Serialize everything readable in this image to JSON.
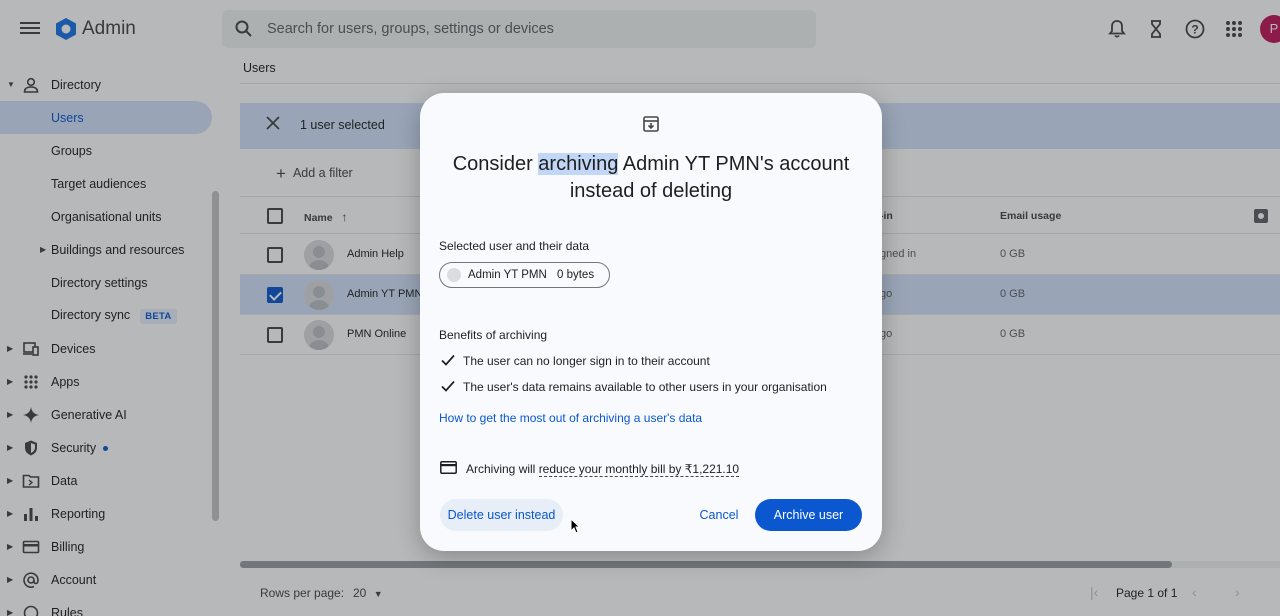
{
  "app": {
    "title": "Admin",
    "search_placeholder": "Search for users, groups, settings or devices",
    "avatar_initial": "P",
    "top_icons": [
      "bell-icon",
      "hourglass-icon",
      "help-icon",
      "apps-grid-icon"
    ]
  },
  "sidebar": {
    "items": [
      {
        "label": "Directory",
        "icon": "person-icon"
      },
      {
        "label": "Users"
      },
      {
        "label": "Groups"
      },
      {
        "label": "Target audiences"
      },
      {
        "label": "Organisational units"
      },
      {
        "label": "Buildings and resources"
      },
      {
        "label": "Directory settings"
      },
      {
        "label": "Directory sync",
        "badge": "BETA"
      },
      {
        "label": "Devices",
        "icon": "devices-icon"
      },
      {
        "label": "Apps",
        "icon": "apps-icon"
      },
      {
        "label": "Generative AI",
        "icon": "sparkle-icon"
      },
      {
        "label": "Security",
        "icon": "shield-icon"
      },
      {
        "label": "Data",
        "icon": "folder-icon"
      },
      {
        "label": "Reporting",
        "icon": "bar-chart-icon"
      },
      {
        "label": "Billing",
        "icon": "credit-card-icon"
      },
      {
        "label": "Account",
        "icon": "at-icon"
      },
      {
        "label": "Rules",
        "icon": "rules-icon"
      }
    ]
  },
  "main": {
    "breadcrumb": "Users",
    "selection_text": "1 user selected",
    "add_filter": "Add a filter",
    "columns": {
      "name": "Name",
      "last_sign_in": "-in",
      "email_usage": "Email usage"
    },
    "rows": [
      {
        "name": "Admin Help",
        "last_sign_in": "gned in",
        "email_usage": "0 GB",
        "checked": false
      },
      {
        "name": "Admin YT PMN",
        "last_sign_in": "go",
        "email_usage": "0 GB",
        "checked": true
      },
      {
        "name": "PMN Online",
        "last_sign_in": "go",
        "email_usage": "0 GB",
        "checked": false
      }
    ],
    "rows_per_page_label": "Rows per page:",
    "rows_per_page": "20",
    "page_label": "Page 1 of 1"
  },
  "dialog": {
    "title_before": "Consider ",
    "title_highlight": "archiving",
    "title_after": " Admin YT PMN's account instead of deleting",
    "selected_label": "Selected user and their data",
    "chip_name": "Admin YT PMN",
    "chip_size": "0 bytes",
    "benefits_label": "Benefits of archiving",
    "benefits": [
      "The user can no longer sign in to their account",
      "The user's data remains available to other users in your organisation"
    ],
    "link": "How to get the most out of archiving a user's data",
    "bill_prefix": "Archiving will ",
    "bill_dashed": "reduce your monthly bill by ₹1,221.10",
    "delete_button": "Delete user instead",
    "cancel_button": "Cancel",
    "archive_button": "Archive user"
  }
}
